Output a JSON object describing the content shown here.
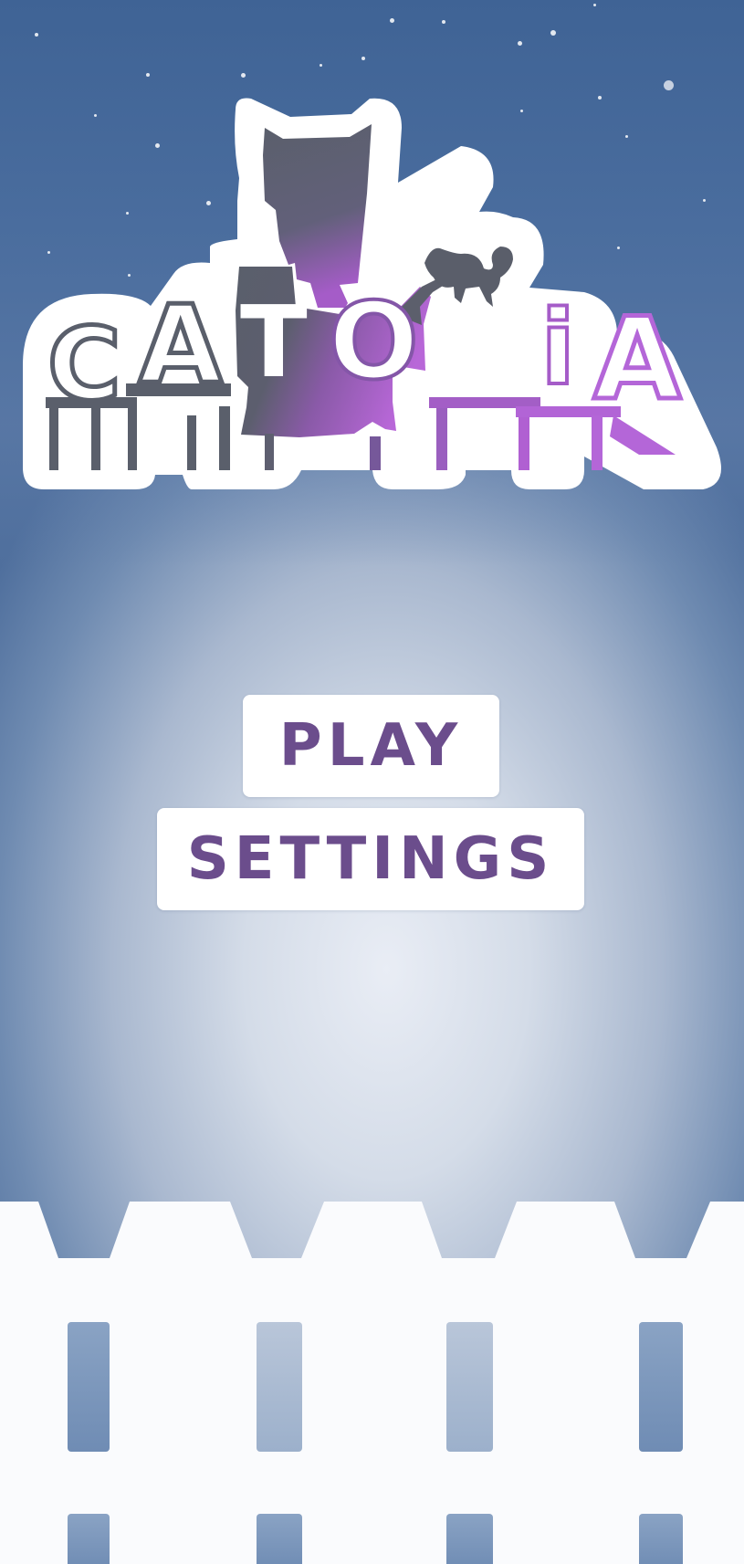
{
  "game": {
    "title": "CATOPiA"
  },
  "menu": {
    "play_label": "PLAY",
    "settings_label": "SETTINGS"
  },
  "colors": {
    "button_text": "#6b4d8c",
    "sky_top": "#3f6395",
    "glow": "#e9edf5",
    "logo_dark": "#5a5f6b",
    "logo_purple": "#b05fd0"
  }
}
